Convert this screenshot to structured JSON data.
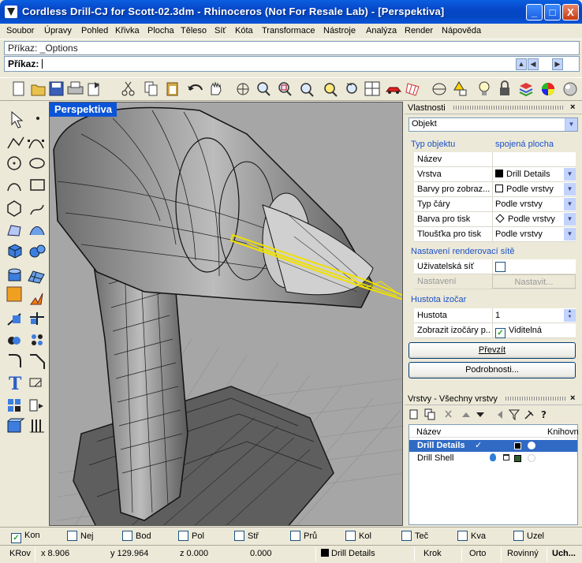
{
  "window": {
    "title": "Cordless Drill-CJ for Scott-02.3dm - Rhinoceros (Not For Resale Lab) - [Perspektiva]",
    "min": "_",
    "max": "□",
    "close": "X"
  },
  "menu": [
    "Soubor",
    "Úpravy",
    "Pohled",
    "Křivka",
    "Plocha",
    "Těleso",
    "Síť",
    "Kóta",
    "Transformace",
    "Nástroje",
    "Analýza",
    "Render",
    "Nápověda"
  ],
  "command": {
    "history": "Příkaz: _Options",
    "prompt": "Příkaz:",
    "value": ""
  },
  "viewport": {
    "label": "Perspektiva"
  },
  "properties": {
    "title": "Vlastnosti",
    "close": "×",
    "object_select": "Objekt",
    "object_type_label": "Typ objektu",
    "object_type_value": "spojená plocha",
    "rows": [
      {
        "label": "Název",
        "value": ""
      },
      {
        "label": "Vrstva",
        "value": "Drill Details"
      },
      {
        "label": "Barvy pro zobraz...",
        "value": "Podle vrstvy"
      },
      {
        "label": "Typ čáry",
        "value": "Podle vrstvy"
      },
      {
        "label": "Barva pro tisk",
        "value": "Podle vrstvy"
      },
      {
        "label": "Tloušťka pro tisk",
        "value": "Podle vrstvy"
      }
    ],
    "mesh_section": "Nastavení renderovací sítě",
    "custom_mesh_label": "Uživatelská síť",
    "settings_label": "Nastavení",
    "settings_button": "Nastavit...",
    "isocurve_section": "Hustota izočar",
    "density_label": "Hustota",
    "density_value": "1",
    "show_iso_label": "Zobrazit izočáry p...",
    "show_iso_value": "Viditelná",
    "match_button": "Převzít",
    "details_button": "Podrobnosti..."
  },
  "layers": {
    "title": "Vrstvy - Všechny vrstvy",
    "close": "×",
    "col_name": "Název",
    "col_lib": "Knihovn",
    "items": [
      {
        "name": "Drill Details",
        "selected": true,
        "color": "#000000"
      },
      {
        "name": "Drill Shell",
        "selected": false,
        "color": "#2e5e2e"
      }
    ]
  },
  "osnaps": [
    {
      "label": "Kon",
      "checked": true
    },
    {
      "label": "Nej",
      "checked": false
    },
    {
      "label": "Bod",
      "checked": false
    },
    {
      "label": "Pol",
      "checked": false
    },
    {
      "label": "Stř",
      "checked": false
    },
    {
      "label": "Prů",
      "checked": false
    },
    {
      "label": "Kol",
      "checked": false
    },
    {
      "label": "Teč",
      "checked": false
    },
    {
      "label": "Kva",
      "checked": false
    },
    {
      "label": "Uzel",
      "checked": false
    }
  ],
  "status": {
    "cplane": "KRov",
    "x": "x 8.906",
    "y": "y 129.964",
    "z": "z 0.000",
    "dist": "0.000",
    "layer": "Drill Details",
    "grid_snap": "Krok",
    "ortho": "Orto",
    "planar": "Rovinný",
    "osnap": "Uch..."
  }
}
